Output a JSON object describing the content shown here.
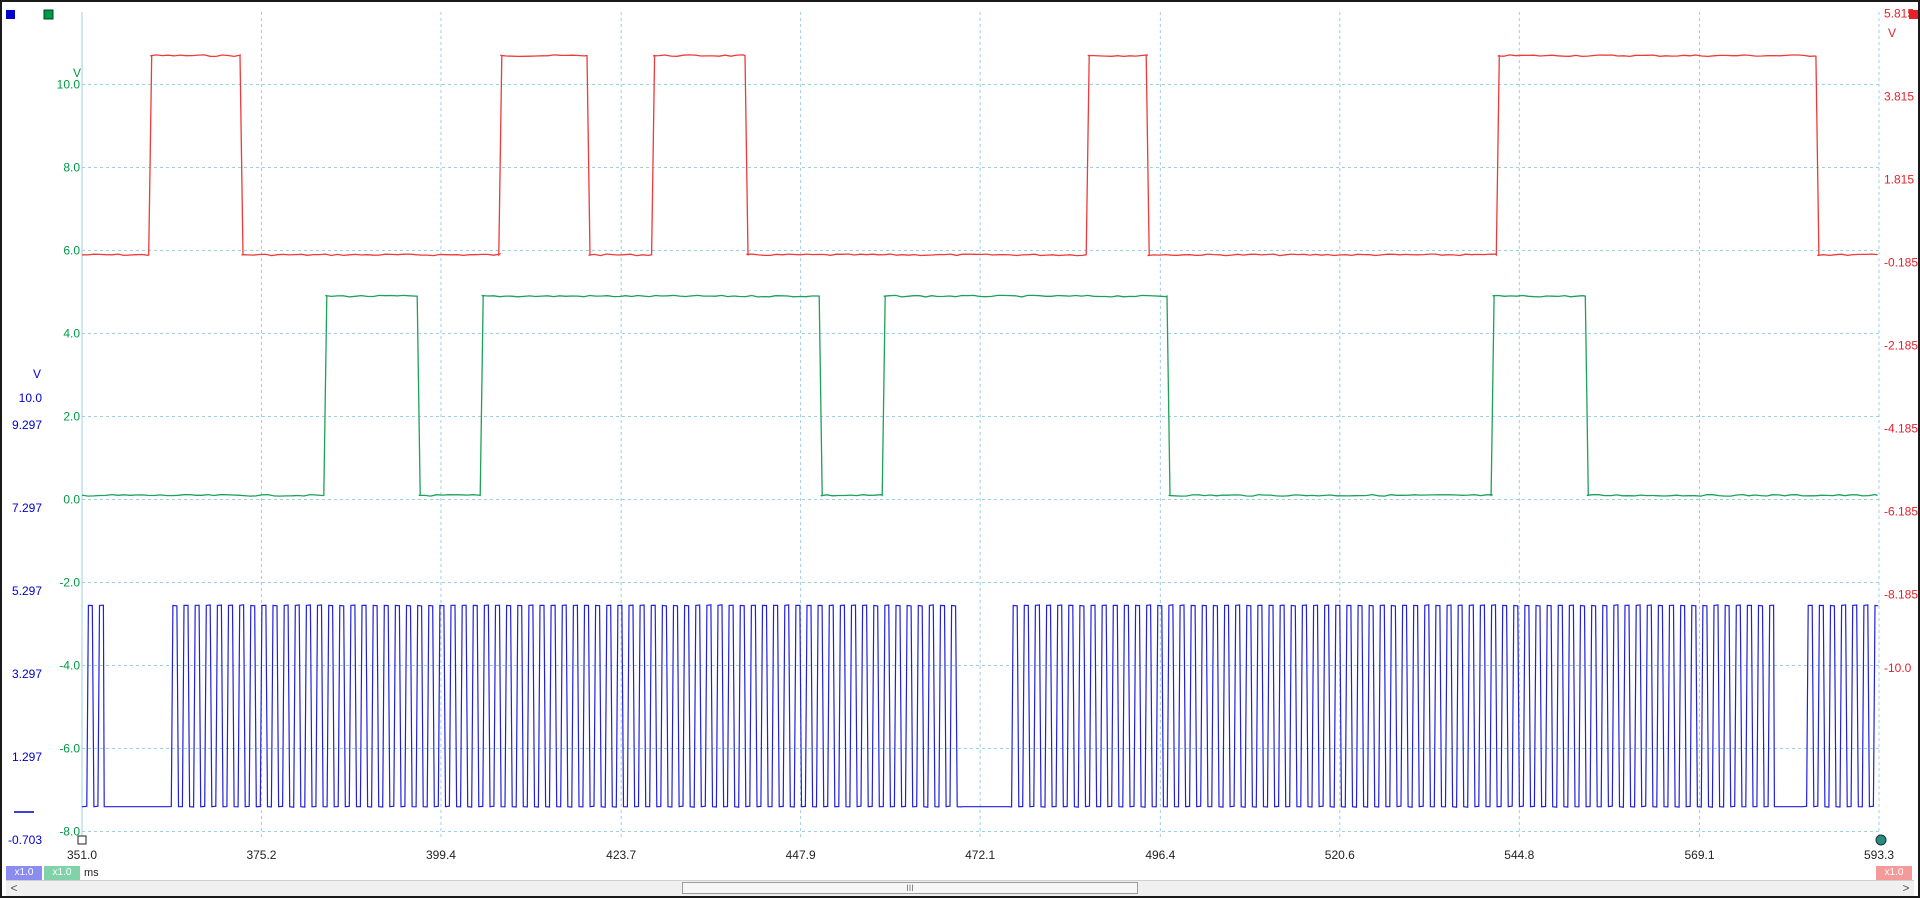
{
  "colors": {
    "ch_a": "#0000cc",
    "ch_b": "#009944",
    "ch_c": "#e8202a",
    "trace_a": "#2020dd",
    "trace_b": "#1ea05a",
    "trace_c": "#ee3a3a",
    "grid": "#9ccfe0"
  },
  "chart_data": {
    "type": "line",
    "x_unit": "ms",
    "x_range": [
      351.0,
      593.3
    ],
    "x_ticks": [
      "351.0",
      "375.2",
      "399.4",
      "423.7",
      "447.9",
      "472.1",
      "496.4",
      "520.6",
      "544.8",
      "569.1",
      "593.3"
    ],
    "grid": true,
    "axes": [
      {
        "id": "a",
        "side": "left-outer",
        "unit": "V",
        "range": [
          -0.703,
          10.0
        ],
        "ticks": [
          "10.0",
          "9.297",
          "7.297",
          "5.297",
          "3.297",
          "1.297",
          "-0.703"
        ]
      },
      {
        "id": "b",
        "side": "left-inner",
        "unit": "V",
        "range": [
          -8.0,
          11.8
        ],
        "ticks": [
          "10.0",
          "8.0",
          "6.0",
          "4.0",
          "2.0",
          "0.0",
          "-2.0",
          "-4.0",
          "-6.0",
          "-8.0"
        ]
      },
      {
        "id": "c",
        "side": "right",
        "unit": "V",
        "range": [
          -10.0,
          5.815
        ],
        "ticks": [
          "5.815",
          "3.815",
          "1.815",
          "-0.185",
          "-2.185",
          "-4.185",
          "-6.185",
          "-8.185",
          "-10.0"
        ]
      }
    ],
    "series": [
      {
        "axis": "c",
        "type": "digital",
        "low": -0.0,
        "high": 4.8,
        "start_level": 0,
        "transitions_ms": [
          360.2,
          372.5,
          407.4,
          419.3,
          428.0,
          440.6,
          486.6,
          494.7,
          541.9,
          585.0
        ]
      },
      {
        "axis": "b",
        "type": "digital",
        "low": 0.1,
        "high": 4.9,
        "start_level": 0,
        "transitions_ms": [
          383.8,
          396.4,
          404.9,
          450.6,
          459.1,
          497.5,
          541.2,
          553.9
        ]
      },
      {
        "axis": "a",
        "type": "clock",
        "low": 0.1,
        "high": 4.95,
        "period_ms": 1.5,
        "idle_ms": [
          [
            353.6,
            362.4
          ],
          [
            469.5,
            475.7
          ],
          [
            578.9,
            582.9
          ]
        ]
      }
    ]
  },
  "footer": {
    "badge_a": "x1.0",
    "badge_b": "x1.0",
    "badge_c": "x1.0",
    "x_unit": "ms",
    "scroll_left": "<",
    "scroll_right": ">",
    "scroll_grip": "III"
  }
}
